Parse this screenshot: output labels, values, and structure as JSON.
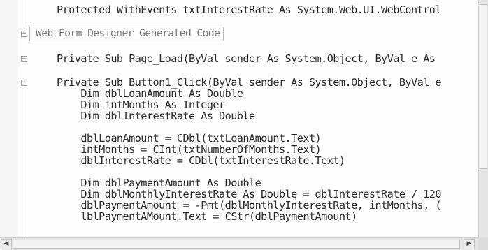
{
  "editor": {
    "lines": [
      "Protected WithEvents txtInterestRate As System.Web.UI.WebControl",
      "Private Sub Page_Load(ByVal sender As System.Object, ByVal e As",
      "Private Sub Button1_Click(ByVal sender As System.Object, ByVal e",
      "    Dim dblLoanAmount As Double",
      "    Dim intMonths As Integer",
      "    Dim dblInterestRate As Double",
      "    dblLoanAmount = CDbl(txtLoanAmount.Text)",
      "    intMonths = CInt(txtNumberOfMonths.Text)",
      "    dblInterestRate = CDbl(txtInterestRate.Text)",
      "    Dim dblPaymentAmount As Double",
      "    Dim dblMonthlyInterestRate As Double = dblInterestRate / 120",
      "    dblPaymentAmount = -Pmt(dblMonthlyInterestRate, intMonths, (",
      "    lblPaymentAMount.Text = CStr(dblPaymentAmount)"
    ],
    "region_label": "Web Form Designer Generated Code"
  },
  "gutter": {
    "expand_glyph": "+",
    "collapse_glyph": "−"
  },
  "scrollbars": {
    "left_arrow": "◀",
    "right_arrow": "▶"
  }
}
